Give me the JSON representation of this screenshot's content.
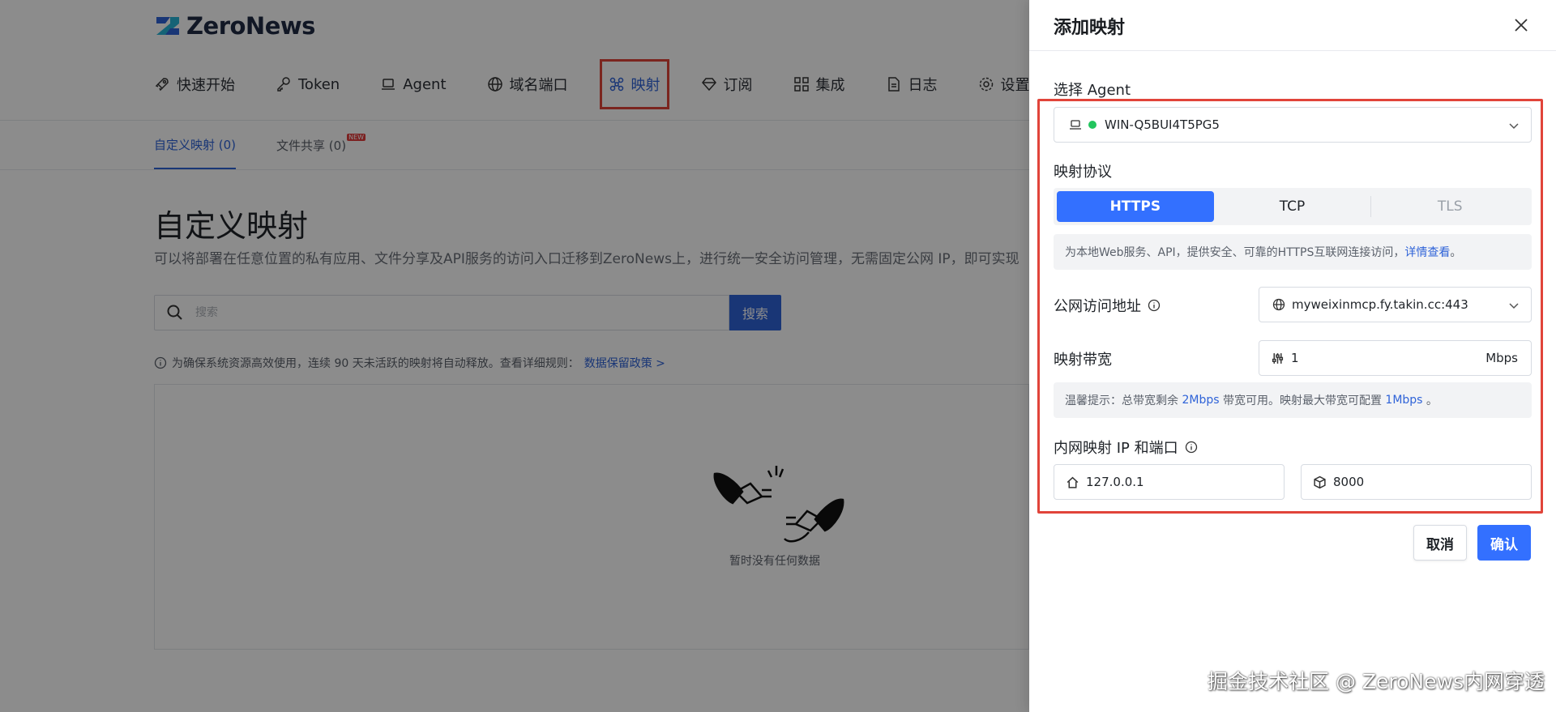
{
  "app": {
    "logo_text": "ZeroNews"
  },
  "nav": {
    "items": [
      {
        "label": "快速开始",
        "icon": "rocket-icon"
      },
      {
        "label": "Token",
        "icon": "key-icon"
      },
      {
        "label": "Agent",
        "icon": "laptop-icon"
      },
      {
        "label": "域名端口",
        "icon": "globe-icon"
      },
      {
        "label": "映射",
        "icon": "mapping-icon",
        "active": true
      },
      {
        "label": "订阅",
        "icon": "diamond-icon"
      },
      {
        "label": "集成",
        "icon": "grid-icon"
      },
      {
        "label": "日志",
        "icon": "document-icon"
      },
      {
        "label": "设置",
        "icon": "gear-icon"
      }
    ]
  },
  "subtabs": [
    {
      "label": "自定义映射 (0)",
      "active": true
    },
    {
      "label": "文件共享 (0)",
      "badge": "NEW"
    }
  ],
  "main": {
    "title": "自定义映射",
    "description": "可以将部署在任意位置的私有应用、文件分享及API服务的访问入口迁移到ZeroNews上，进行统一安全访问管理，无需固定公网 IP，即可实现",
    "search_placeholder": "搜索",
    "search_button": "搜索",
    "notice_text": "为确保系统资源高效使用，连续 90 天未活跃的映射将自动释放。查看详细规则：",
    "notice_link": "数据保留政策 >",
    "empty_text": "暂时没有任何数据"
  },
  "drawer": {
    "title": "添加映射",
    "agent_label": "选择 Agent",
    "agent_value": "WIN-Q5BUI4T5PG5",
    "protocol_label": "映射协议",
    "protocols": [
      {
        "label": "HTTPS",
        "state": "active"
      },
      {
        "label": "TCP",
        "state": "normal"
      },
      {
        "label": "TLS",
        "state": "disabled"
      }
    ],
    "protocol_info": "为本地Web服务、API，提供安全、可靠的HTTPS互联网连接访问，",
    "protocol_info_link": "详情查看",
    "protocol_info_end": "。",
    "public_label": "公网访问地址",
    "public_value": "myweixinmcp.fy.takin.cc:443",
    "bandwidth_label": "映射带宽",
    "bandwidth_value": "1",
    "bandwidth_unit": "Mbps",
    "tip_prefix": "温馨提示：总带宽剩余 ",
    "tip_remaining": "2Mbps",
    "tip_mid": " 带宽可用。映射最大带宽可配置 ",
    "tip_max": "1Mbps",
    "tip_end": " 。",
    "intranet_label": "内网映射 IP 和端口",
    "ip_value": "127.0.0.1",
    "port_value": "8000",
    "cancel_label": "取消",
    "ok_label": "确认"
  },
  "watermark": "掘金技术社区 @ ZeroNews内网穿透",
  "colors": {
    "accent": "#3370ff",
    "highlight_border": "#e1443a",
    "status_online": "#22c55e"
  }
}
